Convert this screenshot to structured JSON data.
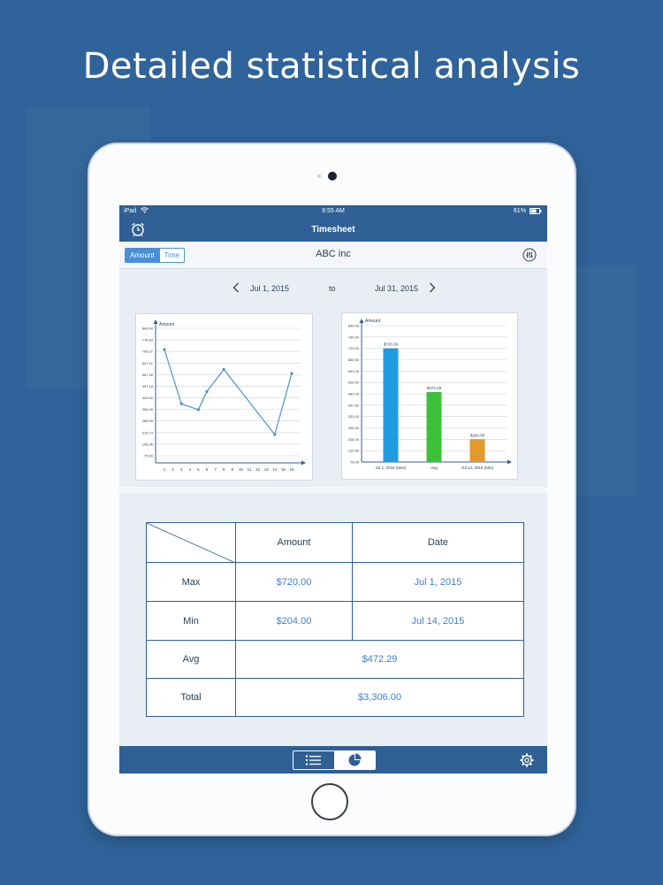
{
  "headline": "Detailed statistical analysis",
  "status_bar": {
    "device": "iPad",
    "time": "9:55 AM",
    "battery": "61%"
  },
  "nav": {
    "title": "Timesheet"
  },
  "toolbar": {
    "segments": [
      "Amount",
      "Time"
    ],
    "selected": "Amount",
    "company": "ABC inc"
  },
  "date_range": {
    "start": "Jul 1, 2015",
    "separator": "to",
    "end": "Jul 31, 2015"
  },
  "colors": {
    "brand": "#2f5f95",
    "accent": "#4a8fd6",
    "bar_max": "#1f9be0",
    "bar_avg": "#3cc13a",
    "bar_min": "#e39a2a",
    "line": "#4a8fd6"
  },
  "chart_data": [
    {
      "type": "line",
      "ylabel": "Amount",
      "x": [
        1,
        2,
        3,
        4,
        5,
        6,
        7,
        8,
        9,
        10,
        11,
        12,
        13,
        14,
        15,
        16
      ],
      "y_ticks": [
        "849.00",
        "778.64",
        "708.27",
        "637.91",
        "567.55",
        "497.18",
        "426.82",
        "356.45",
        "286.09",
        "215.73",
        "145.36",
        "75.00"
      ],
      "ylim": [
        75,
        849
      ],
      "points": [
        [
          1,
          720
        ],
        [
          3,
          390
        ],
        [
          5,
          355
        ],
        [
          6,
          465
        ],
        [
          8,
          600
        ],
        [
          14,
          204
        ],
        [
          16,
          575
        ]
      ]
    },
    {
      "type": "bar",
      "ylabel": "Amount",
      "categories": [
        "Jul 1, 2015 (Max)",
        "Avg",
        "Jul 14, 2015 (Min)"
      ],
      "values": [
        720,
        472.29,
        204
      ],
      "value_labels": [
        "$720.00",
        "$472.29",
        "$204.00"
      ],
      "y_ticks": [
        "849.00",
        "784.50",
        "720.00",
        "655.50",
        "591.00",
        "526.50",
        "462.00",
        "397.50",
        "333.00",
        "268.50",
        "204.00",
        "139.50",
        "75.00"
      ],
      "ylim": [
        75,
        849
      ]
    }
  ],
  "stats_table": {
    "headers": [
      "Amount",
      "Date"
    ],
    "rows": [
      {
        "label": "Max",
        "amount": "$720.00",
        "date": "Jul 1, 2015"
      },
      {
        "label": "Min",
        "amount": "$204.00",
        "date": "Jul 14, 2015"
      },
      {
        "label": "Avg",
        "value": "$472.29"
      },
      {
        "label": "Total",
        "value": "$3,306.00"
      }
    ]
  },
  "tabbar": {
    "tabs": [
      "list-icon",
      "pie-chart-icon"
    ],
    "selected": "pie-chart-icon",
    "settings": "gear-icon"
  }
}
